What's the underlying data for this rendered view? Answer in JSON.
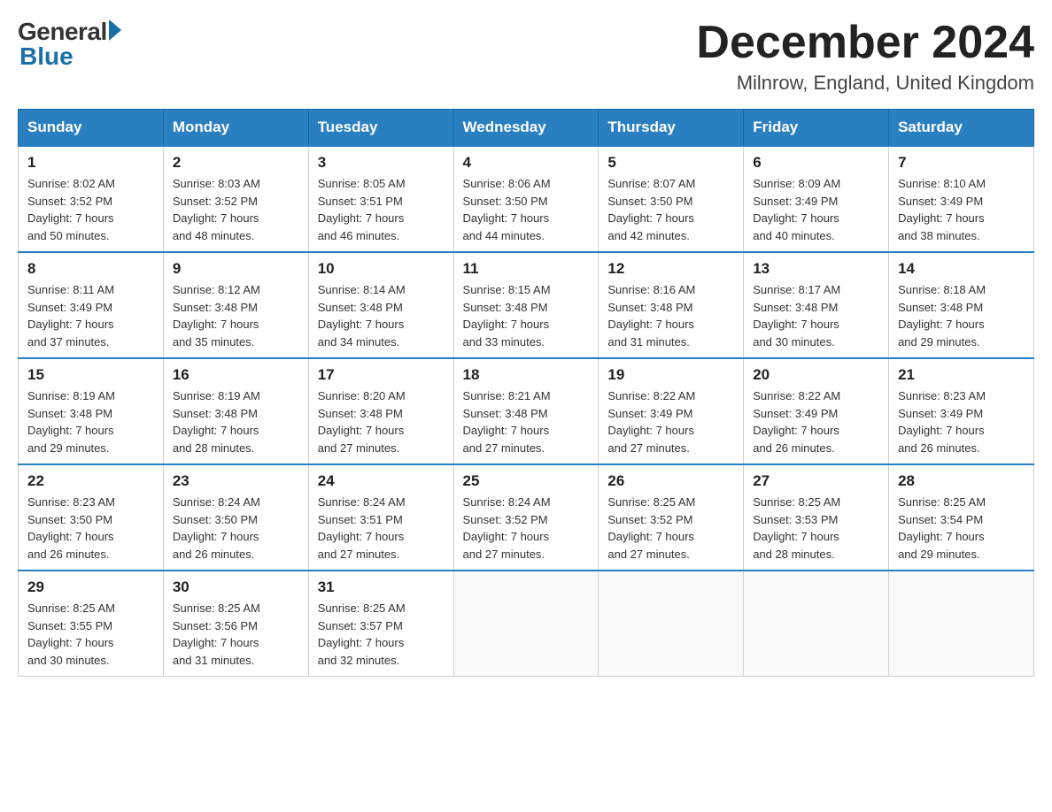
{
  "header": {
    "logo_general": "General",
    "logo_blue": "Blue",
    "month_title": "December 2024",
    "location": "Milnrow, England, United Kingdom"
  },
  "calendar": {
    "weekdays": [
      "Sunday",
      "Monday",
      "Tuesday",
      "Wednesday",
      "Thursday",
      "Friday",
      "Saturday"
    ],
    "weeks": [
      [
        {
          "day": "1",
          "info": "Sunrise: 8:02 AM\nSunset: 3:52 PM\nDaylight: 7 hours\nand 50 minutes."
        },
        {
          "day": "2",
          "info": "Sunrise: 8:03 AM\nSunset: 3:52 PM\nDaylight: 7 hours\nand 48 minutes."
        },
        {
          "day": "3",
          "info": "Sunrise: 8:05 AM\nSunset: 3:51 PM\nDaylight: 7 hours\nand 46 minutes."
        },
        {
          "day": "4",
          "info": "Sunrise: 8:06 AM\nSunset: 3:50 PM\nDaylight: 7 hours\nand 44 minutes."
        },
        {
          "day": "5",
          "info": "Sunrise: 8:07 AM\nSunset: 3:50 PM\nDaylight: 7 hours\nand 42 minutes."
        },
        {
          "day": "6",
          "info": "Sunrise: 8:09 AM\nSunset: 3:49 PM\nDaylight: 7 hours\nand 40 minutes."
        },
        {
          "day": "7",
          "info": "Sunrise: 8:10 AM\nSunset: 3:49 PM\nDaylight: 7 hours\nand 38 minutes."
        }
      ],
      [
        {
          "day": "8",
          "info": "Sunrise: 8:11 AM\nSunset: 3:49 PM\nDaylight: 7 hours\nand 37 minutes."
        },
        {
          "day": "9",
          "info": "Sunrise: 8:12 AM\nSunset: 3:48 PM\nDaylight: 7 hours\nand 35 minutes."
        },
        {
          "day": "10",
          "info": "Sunrise: 8:14 AM\nSunset: 3:48 PM\nDaylight: 7 hours\nand 34 minutes."
        },
        {
          "day": "11",
          "info": "Sunrise: 8:15 AM\nSunset: 3:48 PM\nDaylight: 7 hours\nand 33 minutes."
        },
        {
          "day": "12",
          "info": "Sunrise: 8:16 AM\nSunset: 3:48 PM\nDaylight: 7 hours\nand 31 minutes."
        },
        {
          "day": "13",
          "info": "Sunrise: 8:17 AM\nSunset: 3:48 PM\nDaylight: 7 hours\nand 30 minutes."
        },
        {
          "day": "14",
          "info": "Sunrise: 8:18 AM\nSunset: 3:48 PM\nDaylight: 7 hours\nand 29 minutes."
        }
      ],
      [
        {
          "day": "15",
          "info": "Sunrise: 8:19 AM\nSunset: 3:48 PM\nDaylight: 7 hours\nand 29 minutes."
        },
        {
          "day": "16",
          "info": "Sunrise: 8:19 AM\nSunset: 3:48 PM\nDaylight: 7 hours\nand 28 minutes."
        },
        {
          "day": "17",
          "info": "Sunrise: 8:20 AM\nSunset: 3:48 PM\nDaylight: 7 hours\nand 27 minutes."
        },
        {
          "day": "18",
          "info": "Sunrise: 8:21 AM\nSunset: 3:48 PM\nDaylight: 7 hours\nand 27 minutes."
        },
        {
          "day": "19",
          "info": "Sunrise: 8:22 AM\nSunset: 3:49 PM\nDaylight: 7 hours\nand 27 minutes."
        },
        {
          "day": "20",
          "info": "Sunrise: 8:22 AM\nSunset: 3:49 PM\nDaylight: 7 hours\nand 26 minutes."
        },
        {
          "day": "21",
          "info": "Sunrise: 8:23 AM\nSunset: 3:49 PM\nDaylight: 7 hours\nand 26 minutes."
        }
      ],
      [
        {
          "day": "22",
          "info": "Sunrise: 8:23 AM\nSunset: 3:50 PM\nDaylight: 7 hours\nand 26 minutes."
        },
        {
          "day": "23",
          "info": "Sunrise: 8:24 AM\nSunset: 3:50 PM\nDaylight: 7 hours\nand 26 minutes."
        },
        {
          "day": "24",
          "info": "Sunrise: 8:24 AM\nSunset: 3:51 PM\nDaylight: 7 hours\nand 27 minutes."
        },
        {
          "day": "25",
          "info": "Sunrise: 8:24 AM\nSunset: 3:52 PM\nDaylight: 7 hours\nand 27 minutes."
        },
        {
          "day": "26",
          "info": "Sunrise: 8:25 AM\nSunset: 3:52 PM\nDaylight: 7 hours\nand 27 minutes."
        },
        {
          "day": "27",
          "info": "Sunrise: 8:25 AM\nSunset: 3:53 PM\nDaylight: 7 hours\nand 28 minutes."
        },
        {
          "day": "28",
          "info": "Sunrise: 8:25 AM\nSunset: 3:54 PM\nDaylight: 7 hours\nand 29 minutes."
        }
      ],
      [
        {
          "day": "29",
          "info": "Sunrise: 8:25 AM\nSunset: 3:55 PM\nDaylight: 7 hours\nand 30 minutes."
        },
        {
          "day": "30",
          "info": "Sunrise: 8:25 AM\nSunset: 3:56 PM\nDaylight: 7 hours\nand 31 minutes."
        },
        {
          "day": "31",
          "info": "Sunrise: 8:25 AM\nSunset: 3:57 PM\nDaylight: 7 hours\nand 32 minutes."
        },
        {
          "day": "",
          "info": ""
        },
        {
          "day": "",
          "info": ""
        },
        {
          "day": "",
          "info": ""
        },
        {
          "day": "",
          "info": ""
        }
      ]
    ]
  }
}
